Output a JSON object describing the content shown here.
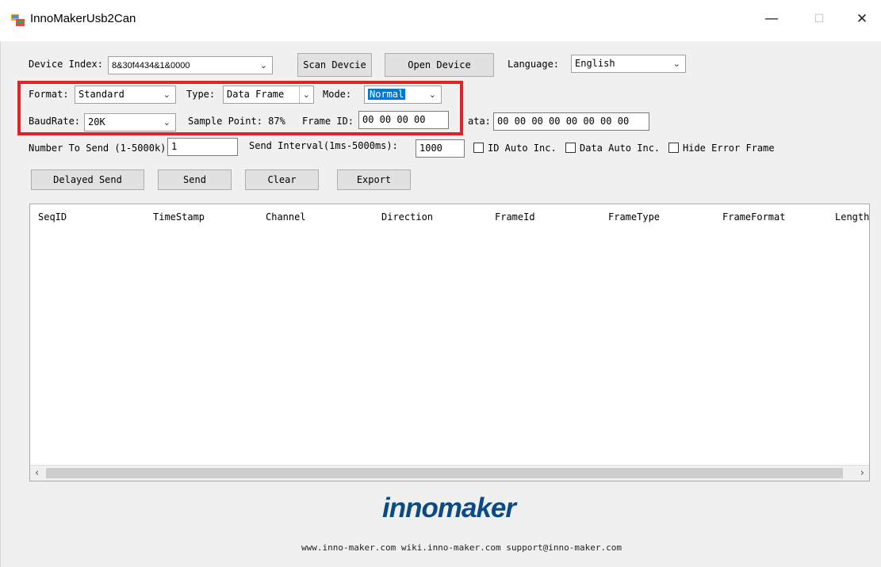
{
  "window": {
    "title": "InnoMakerUsb2Can",
    "minimize_glyph": "—",
    "maximize_glyph": "☐",
    "close_glyph": "✕"
  },
  "device": {
    "index_label": "Device Index:",
    "index_value": "8&30f4434&1&0000",
    "scan_button": "Scan Devcie",
    "open_button": "Open Device",
    "language_label": "Language:",
    "language_value": "English"
  },
  "config": {
    "format_label": "Format:",
    "format_value": "Standard",
    "type_label": "Type:",
    "type_value": "Data Frame",
    "mode_label": "Mode:",
    "mode_value": "Normal",
    "baudrate_label": "BaudRate:",
    "baudrate_value": "20K",
    "sample_point": "Sample Point: 87%",
    "frame_id_label": "Frame ID:",
    "frame_id_value": "00 00 00 00",
    "data_label": "ata:",
    "data_value": "00 00 00 00 00 00 00 00"
  },
  "send": {
    "count_label": "Number To Send (1-5000k)",
    "count_value": "1",
    "interval_label": "Send Interval(1ms-5000ms):",
    "interval_value": "1000",
    "id_auto_inc": "ID Auto Inc.",
    "data_auto_inc": "Data Auto Inc.",
    "hide_error_frame": "Hide Error Frame"
  },
  "actions": {
    "delayed_send": "Delayed Send",
    "send": "Send",
    "clear": "Clear",
    "export": "Export"
  },
  "table": {
    "columns": [
      "SeqID",
      "TimeStamp",
      "Channel",
      "Direction",
      "FrameId",
      "FrameType",
      "FrameFormat",
      "Length"
    ],
    "rows": []
  },
  "footer": {
    "logo": "innomaker",
    "links": "www.inno-maker.com wiki.inno-maker.com support@inno-maker.com"
  },
  "colors": {
    "highlight_border": "#e0232b",
    "logo": "#0a4a86",
    "selection": "#0078d7"
  }
}
